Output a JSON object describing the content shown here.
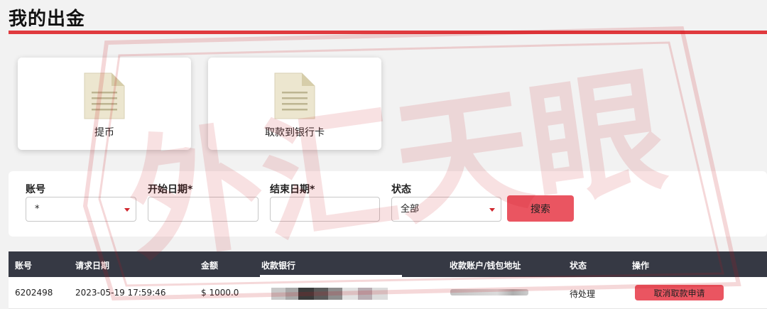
{
  "page": {
    "title": "我的出金"
  },
  "cards": [
    {
      "label": "提币",
      "icon": "document-icon"
    },
    {
      "label": "取款到银行卡",
      "icon": "document-icon"
    }
  ],
  "filters": {
    "account": {
      "label": "账号",
      "value": "*"
    },
    "start_date": {
      "label": "开始日期*",
      "value": ""
    },
    "end_date": {
      "label": "结束日期*",
      "value": ""
    },
    "status": {
      "label": "状态",
      "value": "全部"
    },
    "search_label": "搜索"
  },
  "table": {
    "headers": [
      "账号",
      "请求日期",
      "金额",
      "收款银行",
      "收款账户/钱包地址",
      "状态",
      "操作"
    ],
    "rows": [
      {
        "account": "6202498",
        "date": "2023-05-19 17:59:46",
        "amount": "$ 1000.0",
        "status": "待处理",
        "action": "取消取款申请"
      }
    ]
  },
  "watermark": {
    "text": "外汇天眼"
  },
  "colors": {
    "accent": "#e03a3e",
    "button": "#ea5561",
    "table_header": "#363944"
  }
}
